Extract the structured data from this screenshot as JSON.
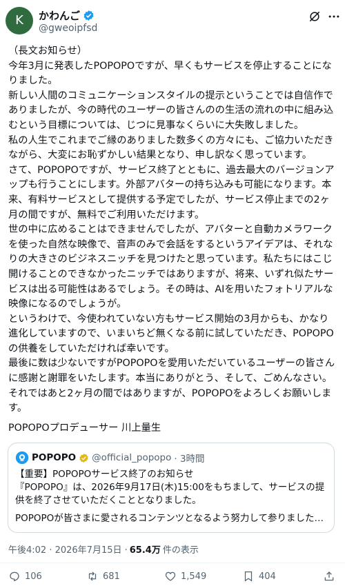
{
  "author": {
    "avatar_letter": "K",
    "name": "かわんご",
    "handle": "@gweoipfsd",
    "verified_color": "#1d9bf0"
  },
  "post": {
    "text": "（長文お知らせ）\n今年3月に発表したPOPOPOですが、早くもサービスを停止することになりました。\n新しい人間のコミュニケーションスタイルの提示ということでは自信作でありましたが、今の時代のユーザーの皆さんのの生活の流れの中に組み込むという目標については、じつに見事なくらいに大失敗しました。\n私の人生でこれまでご縁のありました数多くの方々にも、ご協力いただきながら、大変にお恥ずかしい結果となり、申し訳なく思っています。\nさて、POPOPOですが、サービス終了とともに、過去最大のバージョンアップも行うことにします。外部アバターの持ち込みも可能になります。本来、有料サービスとして提供する予定でしたが、サービス停止までの2ヶ月の間ですが、無料でご利用いただけます。\n世の中に広めることはできませんでしたが、アバターと自動カメラワークを使った自然な映像で、音声のみで会話をするというアイデアは、それなりの大きさのビジネスニッチを見つけたと思っています。私たちにはこじ開けることのできなかったニッチではありますが、将来、いずれ似たサービスは出る可能性はあるでしょう。その時は、AIを用いたフォトリアルな映像になるのでしょうが。\nというわけで、今使われていない方もサービス開始の3月からも、かなり進化していますので、いまいちど無くなる前に試していただき、POPOPOの供養をしていただければ幸いです。\n最後に数は少ないですがPOPOPOを愛用いただいているユーザーの皆さんに感謝と謝罪をいたします。本当にありがとう、そして、ごめんなさい。\nそれではあと2ヶ月の間ではありますが、POPOPOをよろしくお願いします。",
    "signature": "POPOPOプロデューサー 川上量生"
  },
  "quote": {
    "name": "POPOPO",
    "handle": "@official_popopo",
    "time": "· 3時間",
    "text": "【重要】POPOPOサービス終了のお知らせ\n『POPOPO』は、2026年9月17日(木)15:00をもちまして、サービスの提供を終了させていただくこととなりました。",
    "last_line": "POPOPOが皆さまに愛されるコンテンツとなるよう努力して参りましたが、こ…"
  },
  "meta": {
    "datetime": "午後4:02 · 2026年7月15日 ·",
    "views": "65.4万",
    "views_label": "件の表示"
  },
  "actions": {
    "replies": "106",
    "reposts": "681",
    "likes": "1,549",
    "bookmarks": "404"
  },
  "colors": {
    "text": "#0f1419",
    "secondary": "#536471",
    "accent": "#1d9bf0",
    "border": "#cfd9de"
  }
}
